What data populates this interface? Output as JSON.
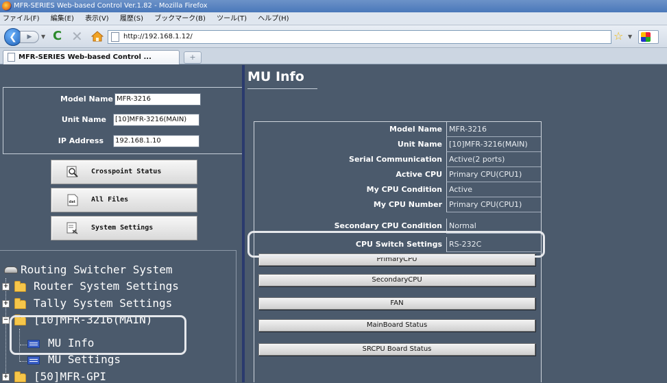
{
  "browser": {
    "window_title": "MFR-SERIES Web-based Control Ver.1.82 - Mozilla Firefox",
    "menu": [
      "ファイル(F)",
      "編集(E)",
      "表示(V)",
      "履歴(S)",
      "ブックマーク(B)",
      "ツール(T)",
      "ヘルプ(H)"
    ],
    "url": "http://192.168.1.12/",
    "tab_title": "MFR-SERIES Web-based Control ...",
    "newtab_label": "+"
  },
  "unit_info": {
    "model_name_label": "Model Name",
    "model_name_value": "MFR-3216",
    "unit_name_label": "Unit Name",
    "unit_name_value": "[10]MFR-3216(MAIN)",
    "ip_address_label": "IP Address",
    "ip_address_value": "192.168.1.10"
  },
  "side_buttons": {
    "crosspoint": "Crosspoint Status",
    "all_files": "All Files",
    "system_settings": "System Settings"
  },
  "tree": {
    "root": "Routing Switcher System",
    "router_settings": "Router System Settings",
    "tally_settings": "Tally System Settings",
    "unit_main": "[10]MFR-3216(MAIN)",
    "mu_info": "MU Info",
    "mu_settings": "MU Settings",
    "gpi": "[50]MFR-GPI"
  },
  "main": {
    "title": "MU Info",
    "rows": [
      {
        "label": "Model Name",
        "value": "MFR-3216"
      },
      {
        "label": "Unit Name",
        "value": "[10]MFR-3216(MAIN)"
      },
      {
        "label": "Serial Communication",
        "value": "Active(2 ports)"
      },
      {
        "label": "Active CPU",
        "value": "Primary CPU(CPU1)"
      },
      {
        "label": "My CPU Condition",
        "value": "Active"
      },
      {
        "label": "My CPU Number",
        "value": "Primary CPU(CPU1)"
      },
      {
        "label": "Secondary CPU Condition",
        "value": "Normal"
      },
      {
        "label": "CPU Switch Settings",
        "value": "RS-232C"
      }
    ],
    "buttons": [
      "PrimaryCPU",
      "SecondaryCPU",
      "FAN",
      "MainBoard Status",
      "SRCPU Board Status"
    ]
  }
}
